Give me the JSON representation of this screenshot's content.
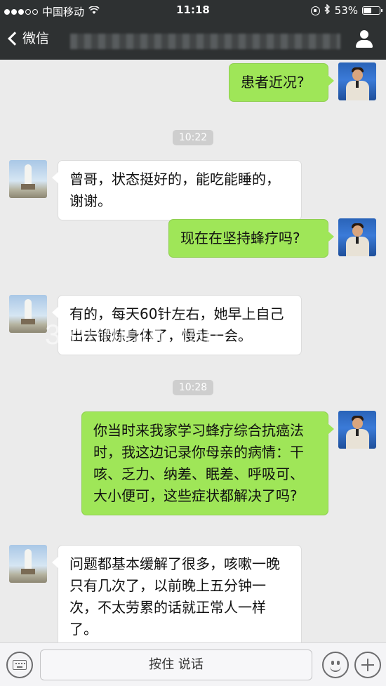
{
  "status_bar": {
    "carrier": "中国移动",
    "time": "11:18",
    "battery": "53%",
    "battery_level": 0.53,
    "signal_bars_filled": 3,
    "signal_bars_total": 5
  },
  "nav": {
    "back_label": "微信"
  },
  "messages": [
    {
      "sender": "self",
      "text": "患者近况?"
    },
    {
      "type": "timestamp",
      "text": "10:22"
    },
    {
      "sender": "other",
      "text": "曾哥，状态挺好的，能吃能睡的，谢谢。"
    },
    {
      "sender": "self",
      "text": "现在在坚持蜂疗吗?"
    },
    {
      "sender": "other",
      "text": "有的，每天60针左右，她早上自己出去锻炼身体了，慢走一会。"
    },
    {
      "type": "timestamp",
      "text": "10:28"
    },
    {
      "sender": "self",
      "text": "你当时来我家学习蜂疗综合抗癌法时，我这边记录你母亲的病情：干咳、乏力、纳差、眠差、呼吸可、大小便可，这些症状都解决了吗?"
    },
    {
      "sender": "other",
      "text": "问题都基本缓解了很多，咳嗽一晚只有几次了，以前晚上五分钟一次，不太劳累的话就正常人一样了。"
    }
  ],
  "watermark": "3fengliao.com",
  "input_bar": {
    "hold_to_talk_label": "按住 说话"
  },
  "colors": {
    "self_bubble": "#9fe658",
    "other_bubble": "#ffffff",
    "chat_background": "#ebebeb",
    "nav_background": "#2e3132"
  }
}
